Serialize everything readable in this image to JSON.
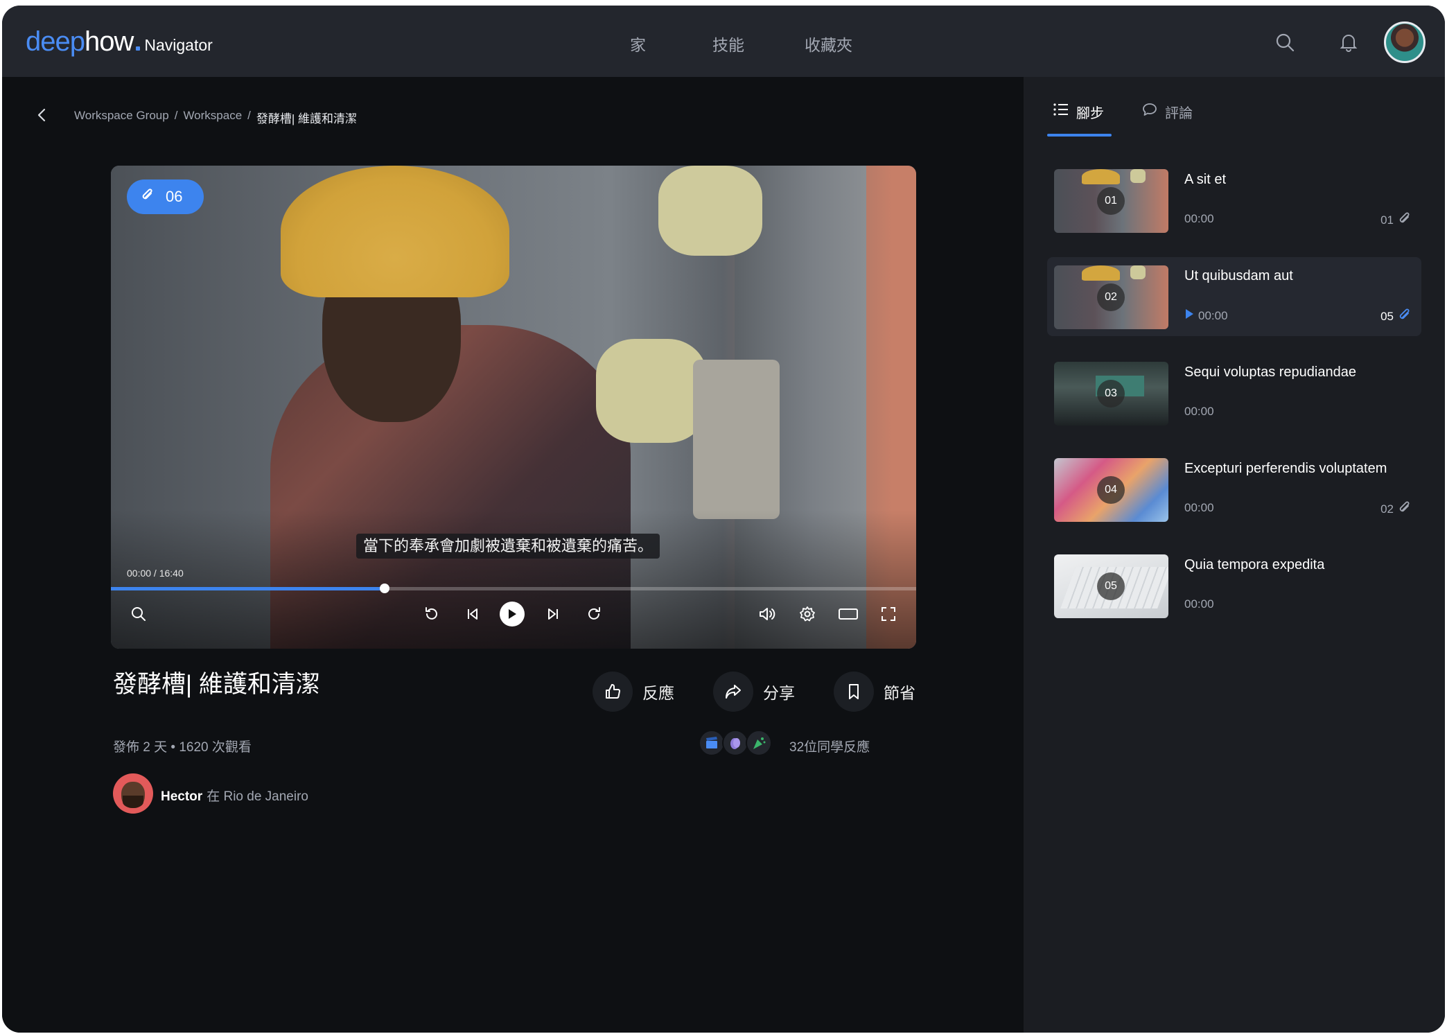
{
  "brand": {
    "deep": "deep",
    "how": "how",
    "navigator": "Navigator"
  },
  "nav": {
    "home": "家",
    "skills": "技能",
    "favorites": "收藏夾"
  },
  "breadcrumb": {
    "group": "Workspace Group",
    "sep": "/",
    "workspace": "Workspace",
    "current": "發酵槽| 維護和清潔"
  },
  "video": {
    "attachment_count": "06",
    "subtitle": "當下的奉承會加劇被遺棄和被遺棄的痛苦。",
    "time": "00:00 / 16:40",
    "progress": 0.34,
    "title": "發酵槽| 維護和清潔"
  },
  "actions": {
    "react": "反應",
    "share": "分享",
    "save": "節省"
  },
  "meta": {
    "posted": "發佈 2 天 • 1620 次觀看",
    "reactions_text": "32位同學反應"
  },
  "author": {
    "name": "Hector",
    "location": "在 Rio de Janeiro"
  },
  "sidebar": {
    "tabs": [
      {
        "label": "腳步"
      },
      {
        "label": "評論"
      }
    ],
    "steps": [
      {
        "num": "01",
        "title": "A sit et",
        "time": "00:00",
        "attachments": "01"
      },
      {
        "num": "02",
        "title": "Ut quibusdam aut",
        "time": "00:00",
        "attachments": "05"
      },
      {
        "num": "03",
        "title": "Sequi voluptas repudiandae",
        "time": "00:00",
        "attachments": ""
      },
      {
        "num": "04",
        "title": "Excepturi perferendis voluptatem",
        "time": "00:00",
        "attachments": "02"
      },
      {
        "num": "05",
        "title": "Quia tempora expedita",
        "time": "00:00",
        "attachments": ""
      }
    ]
  },
  "colors": {
    "accent": "#3d84ee",
    "topbar": "#23262d",
    "background": "#0e1013",
    "sidebar": "#1b1d22"
  }
}
